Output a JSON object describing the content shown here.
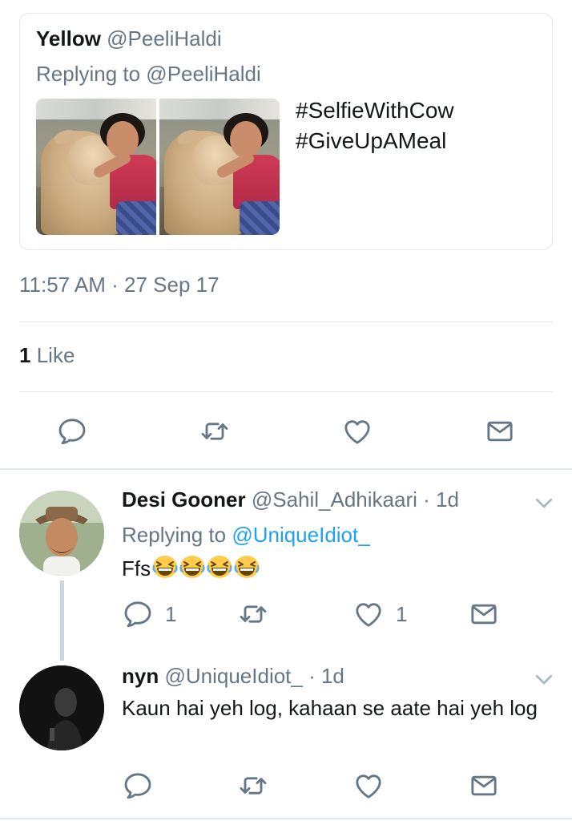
{
  "quoted_tweet": {
    "name": "Yellow",
    "handle": "@PeeliHaldi",
    "replying_to": "Replying to @PeeliHaldi",
    "hashtags": [
      "#SelfieWithCow",
      "#GiveUpAMeal"
    ]
  },
  "main_tweet": {
    "timestamp": "11:57 AM · 27 Sep 17",
    "like_count": "1",
    "like_label": "Like"
  },
  "replies": [
    {
      "name": "Desi Gooner",
      "handle": "@Sahil_Adhikaari",
      "time": "· 1d",
      "replying_prefix": "Replying to",
      "replying_mention": "@UniqueIdiot_",
      "text": "Ffs",
      "emoji_count": 4,
      "reply_count": "1",
      "retweet_count": "",
      "like_count": "1"
    },
    {
      "name": "nyn",
      "handle": "@UniqueIdiot_",
      "time": "· 1d",
      "text": "Kaun hai yeh log, kahaan se aate hai yeh log",
      "reply_count": "",
      "retweet_count": "",
      "like_count": ""
    }
  ],
  "icons": {
    "reply": "reply-icon",
    "retweet": "retweet-icon",
    "like": "heart-icon",
    "message": "envelope-icon",
    "more": "chevron-down-icon",
    "emoji": "grinning-squinting-face-emoji"
  },
  "colors": {
    "text": "#14171a",
    "secondary": "#657786",
    "link": "#1da1f2",
    "border": "#e1e8ed",
    "thread_line": "#ccd6dd"
  }
}
